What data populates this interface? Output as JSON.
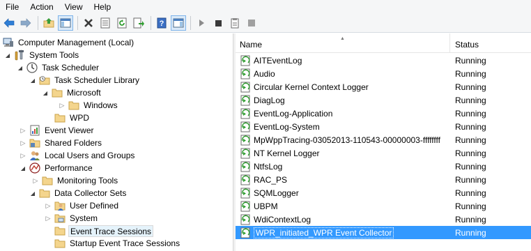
{
  "menubar": {
    "items": [
      "File",
      "Action",
      "View",
      "Help"
    ]
  },
  "toolbar": {
    "buttons": [
      "back-arrow-icon",
      "forward-arrow-icon",
      "up-folder-icon",
      "show-hide-tree-icon",
      "delete-icon",
      "properties-icon",
      "refresh-icon",
      "export-list-icon",
      "help-icon",
      "show-hide-action-pane-icon",
      "start-icon",
      "stop-icon",
      "save-template-icon",
      "new-icon"
    ]
  },
  "tree": {
    "items": [
      {
        "label": "Computer Management (Local)",
        "icon": "computer-management-icon"
      },
      {
        "label": "System Tools",
        "icon": "system-tools-icon"
      },
      {
        "label": "Task Scheduler",
        "icon": "clock-icon"
      },
      {
        "label": "Task Scheduler Library",
        "icon": "folder-icon"
      },
      {
        "label": "Microsoft",
        "icon": "folder-icon"
      },
      {
        "label": "Windows",
        "icon": "folder-icon"
      },
      {
        "label": "WPD",
        "icon": "folder-icon"
      },
      {
        "label": "Event Viewer",
        "icon": "event-viewer-icon"
      },
      {
        "label": "Shared Folders",
        "icon": "shared-folders-icon"
      },
      {
        "label": "Local Users and Groups",
        "icon": "users-icon"
      },
      {
        "label": "Performance",
        "icon": "performance-icon"
      },
      {
        "label": "Monitoring Tools",
        "icon": "folder-icon"
      },
      {
        "label": "Data Collector Sets",
        "icon": "folder-icon"
      },
      {
        "label": "User Defined",
        "icon": "user-defined-icon"
      },
      {
        "label": "System",
        "icon": "system-set-icon"
      },
      {
        "label": "Event Trace Sessions",
        "icon": "folder-icon",
        "selected": true
      },
      {
        "label": "Startup Event Trace Sessions",
        "icon": "folder-icon"
      }
    ]
  },
  "list": {
    "columns": {
      "name": "Name",
      "status": "Status"
    },
    "rows": [
      {
        "name": "AITEventLog",
        "status": "Running"
      },
      {
        "name": "Audio",
        "status": "Running"
      },
      {
        "name": "Circular Kernel Context Logger",
        "status": "Running"
      },
      {
        "name": "DiagLog",
        "status": "Running"
      },
      {
        "name": "EventLog-Application",
        "status": "Running"
      },
      {
        "name": "EventLog-System",
        "status": "Running"
      },
      {
        "name": "MpWppTracing-03052013-110543-00000003-ffffffff",
        "status": "Running"
      },
      {
        "name": "NT Kernel Logger",
        "status": "Running"
      },
      {
        "name": "NtfsLog",
        "status": "Running"
      },
      {
        "name": "RAC_PS",
        "status": "Running"
      },
      {
        "name": "SQMLogger",
        "status": "Running"
      },
      {
        "name": "UBPM",
        "status": "Running"
      },
      {
        "name": "WdiContextLog",
        "status": "Running"
      },
      {
        "name": "WPR_initiated_WPR Event Collector",
        "status": "Running",
        "selected": true
      }
    ]
  },
  "colors": {
    "selection": "#3399ff",
    "tree_selection": "#e5f3fb",
    "folder": "#f4d58d"
  }
}
